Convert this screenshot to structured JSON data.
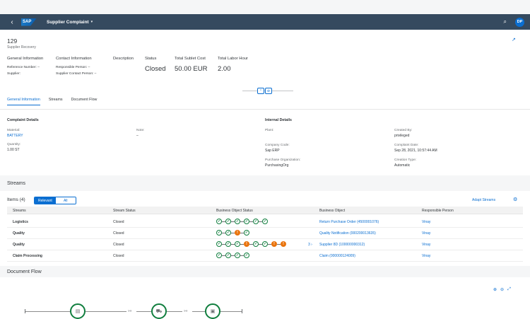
{
  "shell": {
    "logo": "SAP",
    "app_title": "Supplier Complaint",
    "caret": "▾",
    "back": "‹",
    "search": "⌕",
    "avatar": "DP"
  },
  "header": {
    "object_id": "129",
    "object_subtitle": "Supplier Recovery",
    "general": {
      "label": "General Information",
      "ref_label": "Reference Number:",
      "ref_value": "–",
      "supplier_label": "Supplier:",
      "supplier_value": ""
    },
    "contact": {
      "label": "Contact Information",
      "resp_label": "Responsible Person:",
      "resp_value": "–",
      "scp_label": "Supplier Contact Person:",
      "scp_value": "–"
    },
    "description_label": "Description",
    "status": {
      "label": "Status",
      "value": "Closed"
    },
    "sublet": {
      "label": "Total Sublet Cost",
      "value": "50.00 EUR"
    },
    "labor": {
      "label": "Total Labor Hour",
      "value": "2.00"
    }
  },
  "tabs": [
    "General Information",
    "Streams",
    "Document Flow"
  ],
  "complaint_details": {
    "title": "Complaint Details",
    "material_label": "Material:",
    "material_value": "BATTERY",
    "quantity_label": "Quantity:",
    "quantity_value": "1.00 ST",
    "note_label": "Note:",
    "note_value": "–"
  },
  "internal_details": {
    "title": "Internal Details",
    "plant_label": "Plant:",
    "plant_value": "",
    "company_label": "Company Code:",
    "company_value": "Sap ERP",
    "purch_label": "Purchase Organization:",
    "purch_value": "PurchasingOrg",
    "created_label": "Created By:",
    "created_value": "privileged",
    "date_label": "Complaint Date:",
    "date_value": "Sep 28, 2021, 10:57:44 AM",
    "ctype_label": "Creation Type:",
    "ctype_value": "Automatic"
  },
  "streams": {
    "section_title": "Streams",
    "items_title": "Items (4)",
    "seg_relevant": "Relevant",
    "seg_all": "All",
    "adapt": "Adapt Streams",
    "columns": [
      "Streams",
      "Stream Status",
      "Business Object Status",
      "Business Object",
      "Responsible Person"
    ],
    "rows": [
      {
        "name": "Logistics",
        "status": "Closed",
        "object": "Return Purchase Order (4500001076)",
        "person": "Vinay",
        "more": ""
      },
      {
        "name": "Quality",
        "status": "Closed",
        "object": "Quality Notification (000200013635)",
        "person": "Vinay",
        "more": ""
      },
      {
        "name": "Quality",
        "status": "Closed",
        "object": "Supplier 8D (100000000312)",
        "person": "Vinay",
        "more": "3"
      },
      {
        "name": "Claim Processing",
        "status": "Closed",
        "object": "Claim (000000124009)",
        "person": "Vinay",
        "more": ""
      }
    ]
  },
  "document_flow": {
    "title": "Document Flow"
  },
  "colors": {
    "shell": "#354a5f",
    "brand": "#0a6ed1",
    "success": "#107e3e",
    "warning": "#e9730c"
  }
}
